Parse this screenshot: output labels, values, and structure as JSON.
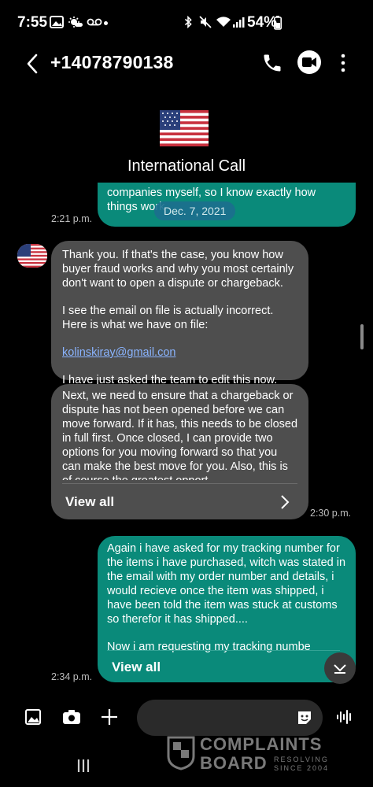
{
  "status_bar": {
    "time": "7:55",
    "battery": "54%"
  },
  "header": {
    "title": "+14078790138"
  },
  "contact": {
    "label": "International Call"
  },
  "messages": {
    "first_partial": {
      "lines": [
        "companies myself, so I know exactly how",
        "things work"
      ],
      "time": "2:21 p.m."
    },
    "date_chip": "Dec. 7, 2021",
    "incoming_1": {
      "p1": "Thank you. If that's the case, you know how buyer fraud works and why you most certainly don't want to open a dispute or chargeback.",
      "p2": "I see the email on file is actually incorrect. Here is what we have on file:",
      "email": "kolinskiray@gmail.con",
      "p3": "I have just asked the team to edit this now."
    },
    "incoming_2": {
      "text": "Next, we need to ensure that a chargeback or dispute has not been opened before we can move forward. If it has, this needs to be closed in full first. Once closed, I can provide two options for you moving forward so that you can make the best move for you. Also, this is of course the greatest opport",
      "view_all": "View all",
      "time": "2:30 p.m."
    },
    "outgoing_1": {
      "p1": "Again i have asked for my tracking number for the items i have purchased,  witch was stated in the email with my order number and details, i would recieve once the item was shipped,  i have been told the item was stuck at customs so therefor it has shipped....",
      "p2": "Now i am requesting my tracking numbe",
      "view_all": "View all",
      "time": "2:34 p.m."
    }
  },
  "watermark": {
    "line1": "COMPLAINTS",
    "line2": "BOARD",
    "tag1": "RESOLVING",
    "tag2": "SINCE 2004"
  },
  "colors": {
    "incoming": "#4e4e4e",
    "outgoing": "#0a8a7a",
    "date_chip": "#1c6f8f"
  }
}
